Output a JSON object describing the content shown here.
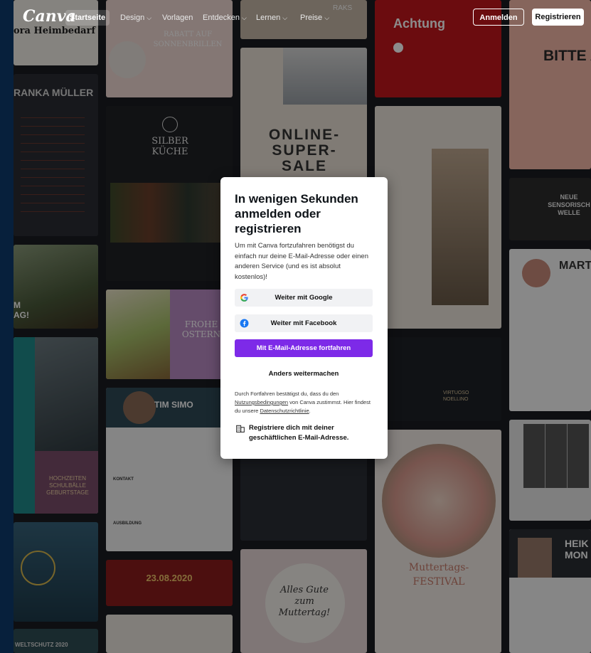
{
  "nav": {
    "logo": "Canva",
    "items": [
      {
        "label": "Startseite",
        "chevron": false
      },
      {
        "label": "Design",
        "chevron": true
      },
      {
        "label": "Vorlagen",
        "chevron": false
      },
      {
        "label": "Entdecken",
        "chevron": true
      },
      {
        "label": "Lernen",
        "chevron": true
      },
      {
        "label": "Preise",
        "chevron": true
      }
    ],
    "chevron_glyph": "⌵",
    "login_label": "Anmelden",
    "register_label": "Registrieren"
  },
  "background": {
    "t_name1": "ora Heimbedarf",
    "t_franka": "RANKA MÜLLER",
    "t_rabatt": "RABATT AUF SONNENBRILLEN",
    "t_silber": "SILBER KÜCHE",
    "t_online": "ONLINE-SUPER-SALE",
    "t_achtung": "Achtung",
    "t_bitte": "BITTE AL MITMACH",
    "t_neue": "NEUE SENSORISCH WELLE",
    "t_mart": "MART LUDW",
    "t_frohe": "FROHE OSTERN",
    "t_tim": "TIM SIMO",
    "t_hochzeit": "HOCHZEITEN SCHULBÄLLE GEBURTSTAGE",
    "t_datum": "23.08.2020",
    "t_muttertag": "Alles Gute zum Muttertag!",
    "t_festival": "Muttertags-FESTIVAL",
    "t_virtuoso": "VIRTUOSO NOELLINO",
    "t_heik": "HEIK MON",
    "t_weltschutz": "WELTSCHUTZ 2020",
    "t_raks": "RAKS",
    "t_m": "M AG!",
    "t_kontakt": "KONTAKT",
    "t_ausbildung": "AUSBILDUNG"
  },
  "modal": {
    "title": "In wenigen Sekunden anmelden oder registrieren",
    "description": "Um mit Canva fortzufahren benötigst du einfach nur deine E-Mail-Adresse oder einen anderen Service (und es ist absolut kostenlos)!",
    "google_label": "Weiter mit Google",
    "facebook_label": "Weiter mit Facebook",
    "email_label": "Mit E-Mail-Adresse fortfahren",
    "other_label": "Anders weitermachen",
    "legal_pre": "Durch Fortfahren bestätigst du, dass du den ",
    "legal_link1": "Nutzungsbedingungen",
    "legal_mid": " von Canva zustimmst. Hier findest du unsere ",
    "legal_link2": "Datenschutzrichtlinie",
    "legal_end": ".",
    "business_label": "Registriere dich mit deiner geschäftlichen E-Mail-Adresse."
  },
  "colors": {
    "accent": "#7d2ae8",
    "google_blue": "#4285F4",
    "facebook_blue": "#1877F2"
  }
}
